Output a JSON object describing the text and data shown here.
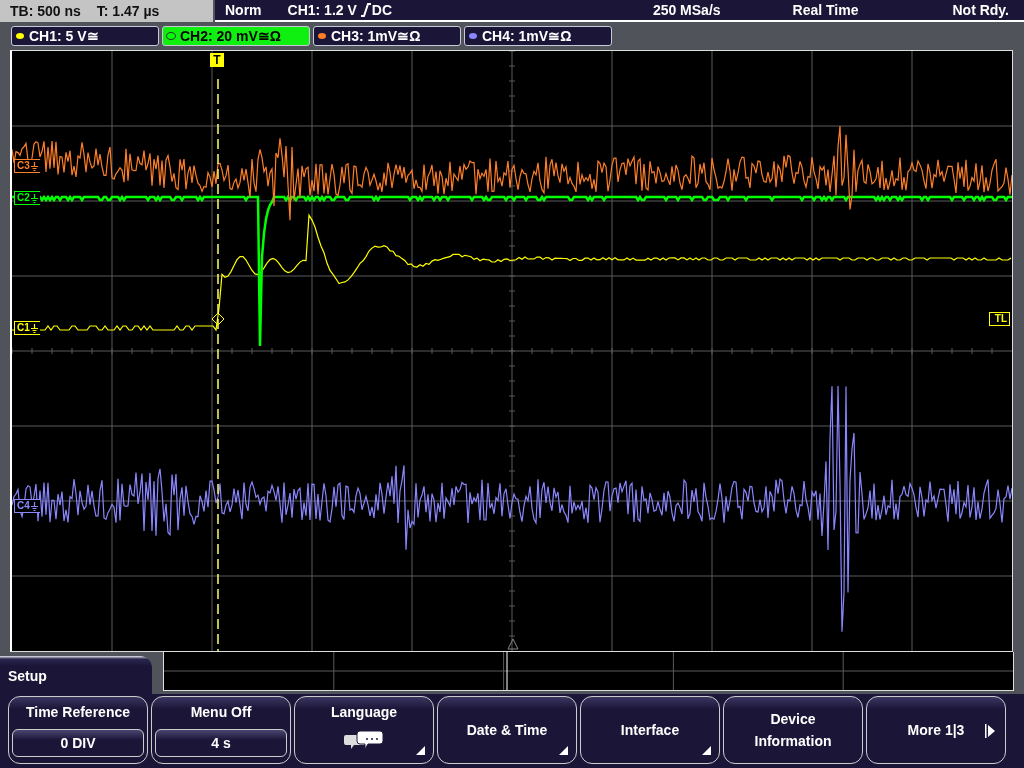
{
  "timebase": {
    "tb": "TB: 500 ns",
    "t": "T: 1.47 µs"
  },
  "trigger": {
    "mode": "Norm",
    "threshold": "CH1: 1.2 V",
    "coupling": "DC"
  },
  "acquisition": {
    "sample_rate": "250 MSa/s",
    "mode": "Real Time",
    "state": "Not Rdy."
  },
  "channels": [
    {
      "label": "CH1: 5 V≅",
      "color": "#ffff00",
      "selected": false
    },
    {
      "label": "CH2: 20 mV≅Ω",
      "color": "#00ff00",
      "selected": true
    },
    {
      "label": "CH3: 1mV≅Ω",
      "color": "#ff7f27",
      "selected": false
    },
    {
      "label": "CH4: 1mV≅Ω",
      "color": "#8a86ff",
      "selected": false
    }
  ],
  "display": {
    "trigger_marker": "T",
    "channel_markers": [
      {
        "label": "C3",
        "color": "#ff7f27"
      },
      {
        "label": "C2",
        "color": "#00ff00"
      },
      {
        "label": "C1",
        "color": "#ffff00"
      },
      {
        "label": "C4",
        "color": "#8a86ff"
      }
    ],
    "trigger_level_marker": "TL"
  },
  "menu": {
    "title": "Setup",
    "buttons": [
      {
        "kind": "value",
        "label": "Time Reference",
        "value": "0 DIV"
      },
      {
        "kind": "value",
        "label": "Menu Off",
        "value": "4 s"
      },
      {
        "kind": "icon",
        "label": "Language",
        "submenu": true
      },
      {
        "kind": "plain",
        "label": "Date & Time",
        "submenu": true
      },
      {
        "kind": "plain",
        "label": "Interface",
        "submenu": true
      },
      {
        "kind": "plain",
        "label": "Device Information",
        "submenu": false
      },
      {
        "kind": "more",
        "label": "More 1|3"
      }
    ]
  }
}
